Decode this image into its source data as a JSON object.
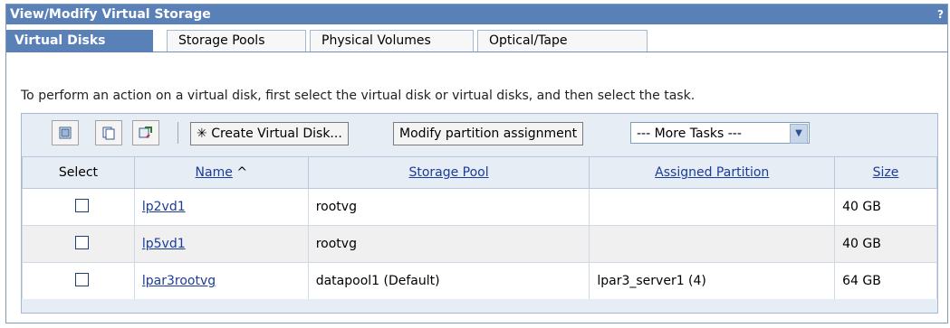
{
  "window": {
    "title": "View/Modify Virtual Storage",
    "help": "?"
  },
  "tabs": [
    {
      "label": "Virtual Disks"
    },
    {
      "label": "Storage Pools"
    },
    {
      "label": "Physical Volumes"
    },
    {
      "label": "Optical/Tape"
    }
  ],
  "intro": "To perform an action on a virtual disk, first select the virtual disk or virtual disks, and then select the task.",
  "toolbar": {
    "icons": [
      "select-all-icon",
      "deselect-all-icon",
      "refresh-icon"
    ],
    "create_label": "Create Virtual Disk...",
    "modify_label": "Modify partition assignment",
    "more_tasks": "--- More Tasks ---"
  },
  "table": {
    "headers": {
      "select": "Select",
      "name": "Name",
      "sort": "^",
      "pool": "Storage Pool",
      "partition": "Assigned Partition",
      "size": "Size"
    },
    "rows": [
      {
        "name": "lp2vd1",
        "pool": "rootvg",
        "partition": "",
        "size": "40 GB"
      },
      {
        "name": "lp5vd1",
        "pool": "rootvg",
        "partition": "",
        "size": "40 GB"
      },
      {
        "name": "lpar3rootvg",
        "pool": "datapool1 (Default)",
        "partition": "lpar3_server1 (4)",
        "size": "64 GB"
      }
    ]
  }
}
